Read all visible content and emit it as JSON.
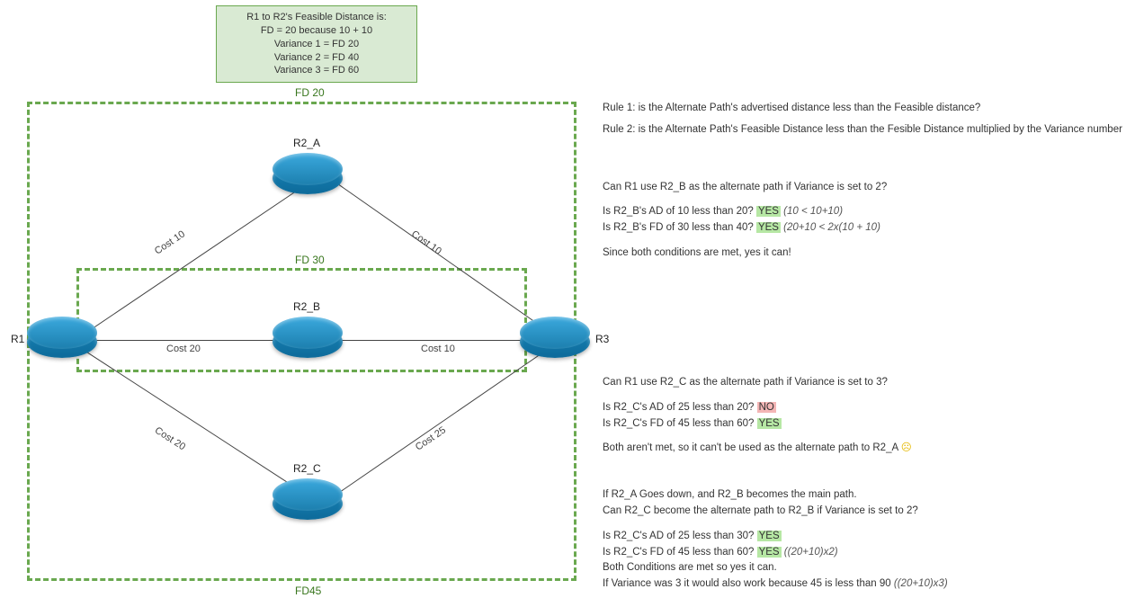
{
  "fdbox": {
    "l1": "R1 to R2's Feasible Distance is:",
    "l2": "FD = 20 because 10 + 10",
    "l3": "Variance 1 = FD 20",
    "l4": "Variance 2 = FD 40",
    "l5": "Variance 3 = FD 60"
  },
  "fdlabels": {
    "fd20": "FD 20",
    "fd30": "FD 30",
    "fd45": "FD45"
  },
  "routers": {
    "r1": "R1",
    "r2a": "R2_A",
    "r2b": "R2_B",
    "r2c": "R2_C",
    "r3": "R3"
  },
  "links": {
    "r1_r2a": "Cost 10",
    "r2a_r3": "Cost 10",
    "r1_r2b": "Cost 20",
    "r2b_r3": "Cost 10",
    "r1_r2c": "Cost 20",
    "r2c_r3": "Cost 25"
  },
  "rules": {
    "rule1": "Rule 1: is the Alternate Path's advertised distance less than the Feasible distance?",
    "rule2": "Rule 2: is the Alternate Path's Feasible Distance less than the Fesible Distance multiplied by the Variance number"
  },
  "q1": {
    "title": "Can R1 use R2_B as the alternate path if Variance is set to 2?",
    "l1a": "Is R2_B's AD of 10 less than 20? ",
    "l1b": "YES",
    "l1c": " (10 < 10+10)",
    "l2a": "Is R2_B's FD of 30 less than 40? ",
    "l2b": "YES",
    "l2c": " (20+10 < 2x(10 + 10)",
    "concl": "Since both conditions are met, yes it can!"
  },
  "q2": {
    "title": "Can R1 use R2_C as the alternate path if Variance is set to 3?",
    "l1a": "Is R2_C's AD of 25 less than 20? ",
    "l1b": "NO",
    "l2a": "Is R2_C's FD of 45 less than 60? ",
    "l2b": "YES",
    "concl": "Both aren't met, so it can't be used as the alternate path to R2_A ",
    "emoji": "☹"
  },
  "q3": {
    "p1": "If R2_A Goes down, and R2_B becomes the main path.",
    "p2": "Can R2_C become the alternate path to R2_B if Variance is set to 2?",
    "l1a": "Is R2_C's AD of 25 less than 30? ",
    "l1b": "YES",
    "l2a": "Is R2_C's FD of 45 less than 60? ",
    "l2b": "YES",
    "l2c": " ((20+10)x2)",
    "c1": "Both Conditions are met so yes it can.",
    "c2": "If Variance was 3 it would also work because 45 is less than 90 ",
    "c2b": "((20+10)x3)"
  }
}
